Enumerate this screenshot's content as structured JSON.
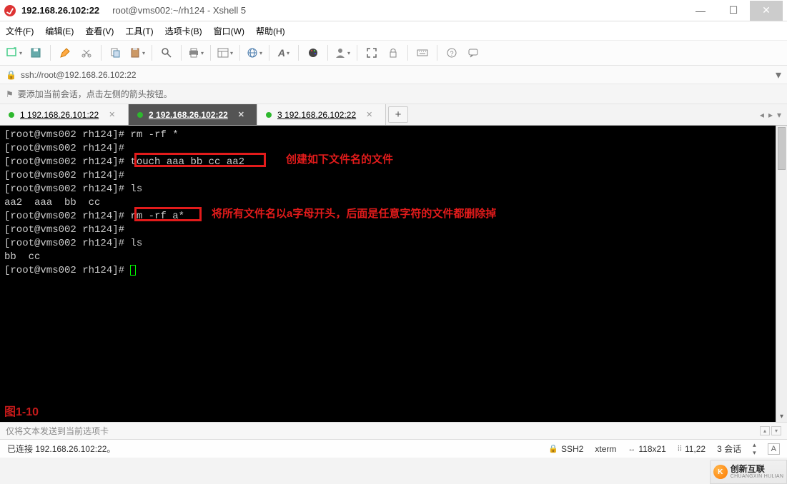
{
  "window": {
    "address": "192.168.26.102:22",
    "title": "root@vms002:~/rh124 - Xshell 5"
  },
  "menu": {
    "file": "文件(F)",
    "edit": "编辑(E)",
    "view": "查看(V)",
    "tools": "工具(T)",
    "tabs": "选项卡(B)",
    "window": "窗口(W)",
    "help": "帮助(H)"
  },
  "toolbar_icons": {
    "new": "new-terminal-icon",
    "save": "save-icon",
    "pencil": "pencil-icon",
    "cut": "scissors-icon",
    "copy": "copy-icon",
    "paste": "paste-icon",
    "search": "search-icon",
    "print": "printer-icon",
    "panel": "panel-icon",
    "globe": "globe-icon",
    "font": "font-icon",
    "color": "palette-icon",
    "profile": "profile-icon",
    "fullscreen": "fullscreen-icon",
    "lock": "lock-icon",
    "keyboard": "keyboard-icon",
    "help": "help-icon",
    "chat": "chat-icon"
  },
  "address_row": {
    "proto_url": "ssh://root@192.168.26.102:22"
  },
  "hint_row": {
    "text": "要添加当前会话，点击左侧的箭头按钮。"
  },
  "tabs": [
    {
      "num": "1",
      "label": "192.168.26.101:22",
      "active": false
    },
    {
      "num": "2",
      "label": "192.168.26.102:22",
      "active": true
    },
    {
      "num": "3",
      "label": "192.168.26.102:22",
      "active": false
    }
  ],
  "terminal": {
    "lines": [
      "[root@vms002 rh124]# rm -rf *",
      "[root@vms002 rh124]#",
      "[root@vms002 rh124]# touch aaa bb cc aa2",
      "[root@vms002 rh124]#",
      "[root@vms002 rh124]# ls",
      "aa2  aaa  bb  cc",
      "[root@vms002 rh124]# rm -rf a*",
      "[root@vms002 rh124]#",
      "[root@vms002 rh124]# ls",
      "bb  cc",
      "[root@vms002 rh124]# "
    ],
    "highlight1_cmd": "touch aaa bb cc aa2",
    "highlight2_cmd": "rm -rf a*",
    "annotation1": "创建如下文件名的文件",
    "annotation2": "将所有文件名以a字母开头，后面是任意字符的文件都删除掉",
    "figure_label": "图1-10"
  },
  "send_row": {
    "text": "仅将文本发送到当前选项卡"
  },
  "status": {
    "conn": "已连接 192.168.26.102:22。",
    "ssh": "SSH2",
    "term": "xterm",
    "size": "118x21",
    "pos": "11,22",
    "sessions_label": "3 会话"
  },
  "watermark": {
    "brand": "创新互联",
    "sub": "CHUANGXIN HULIAN"
  }
}
